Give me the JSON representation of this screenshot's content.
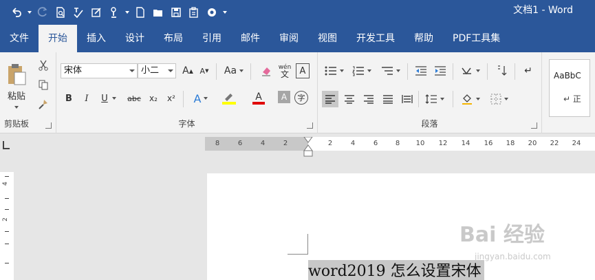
{
  "window": {
    "title": "文档1 - Word"
  },
  "quick_access": [
    "undo-icon",
    "redo-icon",
    "print-preview-icon",
    "spelling-icon",
    "edit-icon",
    "touch-mode-icon",
    "new-document-icon",
    "open-icon",
    "save-icon",
    "clipboard-icon",
    "settings-icon"
  ],
  "tabs": [
    {
      "label": "文件",
      "active": false
    },
    {
      "label": "开始",
      "active": true
    },
    {
      "label": "插入",
      "active": false
    },
    {
      "label": "设计",
      "active": false
    },
    {
      "label": "布局",
      "active": false
    },
    {
      "label": "引用",
      "active": false
    },
    {
      "label": "邮件",
      "active": false
    },
    {
      "label": "审阅",
      "active": false
    },
    {
      "label": "视图",
      "active": false
    },
    {
      "label": "开发工具",
      "active": false
    },
    {
      "label": "帮助",
      "active": false
    },
    {
      "label": "PDF工具集",
      "active": false
    }
  ],
  "ribbon": {
    "clipboard": {
      "paste_label": "粘贴",
      "group_label": "剪贴板"
    },
    "font": {
      "font_name": "宋体",
      "font_size": "小二",
      "grow": "A",
      "shrink": "A",
      "case": "Aa",
      "phonetic": "wén",
      "bold": "B",
      "italic": "I",
      "underline": "U",
      "strike": "abc",
      "subscript": "x₂",
      "superscript": "x²",
      "group_label": "字体"
    },
    "paragraph": {
      "group_label": "段落"
    },
    "styles": {
      "preview": "AaBbC",
      "sub": "↵ 正"
    }
  },
  "ruler": {
    "left_ticks": [
      "8",
      "6",
      "4",
      "2"
    ],
    "right_ticks": [
      "2",
      "4",
      "6",
      "8",
      "10",
      "12",
      "14",
      "16",
      "18",
      "20",
      "22",
      "24"
    ],
    "vertical_ticks": [
      "4",
      "2"
    ]
  },
  "document": {
    "text": "word2019 怎么设置宋体"
  },
  "watermark": {
    "main": "Bai 经验",
    "sub": "jingyan.baidu.com"
  },
  "colors": {
    "accent": "#2b579a",
    "highlight": "#ffff00",
    "font_color": "#e00000"
  }
}
